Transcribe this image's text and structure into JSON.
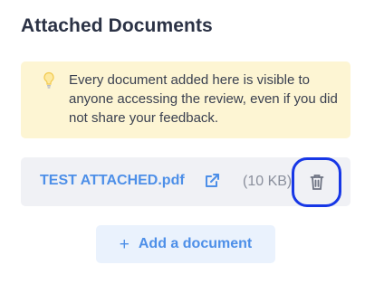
{
  "section": {
    "title": "Attached Documents"
  },
  "notice": {
    "icon": "lightbulb-icon",
    "text": "Every document added here is visible to anyone accessing the review, even if you did not share your feedback."
  },
  "attachment": {
    "name": "TEST ATTACHED.pdf",
    "size": "(10 KB)",
    "link_icon": "external-link-icon",
    "delete_icon": "trash-icon"
  },
  "add_button": {
    "icon": "+",
    "label": "Add a document"
  },
  "colors": {
    "accent": "#4d8fe8",
    "highlight": "#1737e6",
    "notice_bg": "#fdf5d3",
    "row_bg": "#f0f1f5"
  }
}
